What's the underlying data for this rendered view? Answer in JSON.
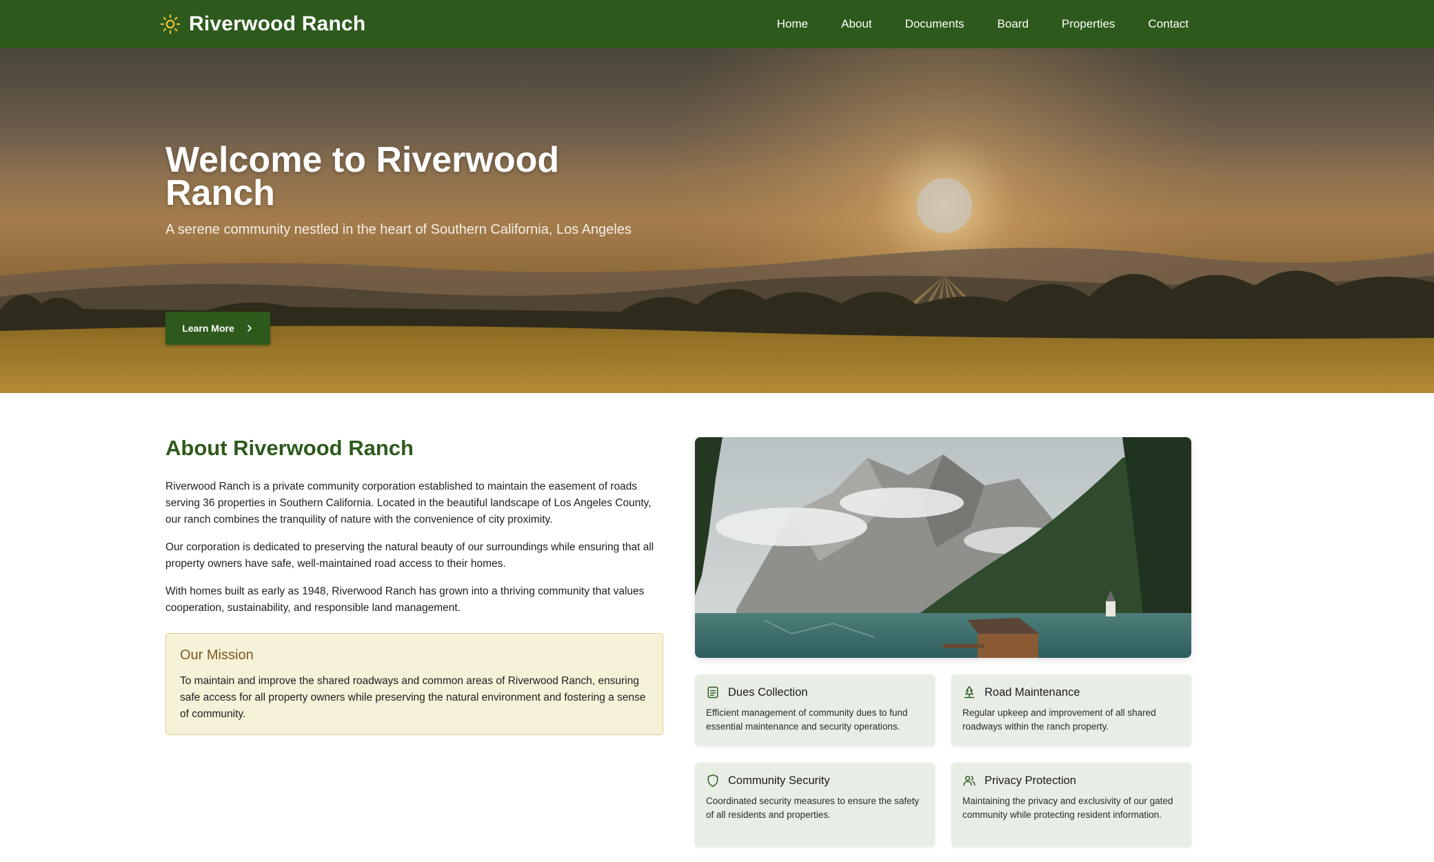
{
  "brand": {
    "name": "Riverwood Ranch",
    "icon": "sun-icon"
  },
  "nav": {
    "items": [
      {
        "label": "Home"
      },
      {
        "label": "About"
      },
      {
        "label": "Documents"
      },
      {
        "label": "Board"
      },
      {
        "label": "Properties"
      },
      {
        "label": "Contact"
      }
    ]
  },
  "hero": {
    "title": "Welcome to Riverwood Ranch",
    "subtitle": "A serene community nestled in the heart of Southern California, Los Angeles",
    "button_label": "Learn More",
    "button_icon": "chevron-right-icon"
  },
  "about": {
    "title": "About Riverwood Ranch",
    "paragraphs": [
      "Riverwood Ranch is a private community corporation established to maintain the easement of roads serving 36 properties in Southern California. Located in the beautiful landscape of Los Angeles County, our ranch combines the tranquility of nature with the convenience of city proximity.",
      "Our corporation is dedicated to preserving the natural beauty of our surroundings while ensuring that all property owners have safe, well-maintained road access to their homes.",
      "With homes built as early as 1948, Riverwood Ranch has grown into a thriving community that values cooperation, sustainability, and responsible land management."
    ]
  },
  "mission": {
    "title": "Our Mission",
    "text": "To maintain and improve the shared roadways and common areas of Riverwood Ranch, ensuring safe access for all property owners while preserving the natural environment and fostering a sense of community."
  },
  "features": [
    {
      "title": "Dues Collection",
      "icon": "document-icon",
      "description": "Efficient management of community dues to fund essential maintenance and security operations."
    },
    {
      "title": "Road Maintenance",
      "icon": "tree-icon",
      "description": "Regular upkeep and improvement of all shared roadways within the ranch property."
    },
    {
      "title": "Community Security",
      "icon": "shield-icon",
      "description": "Coordinated security measures to ensure the safety of all residents and properties."
    },
    {
      "title": "Privacy Protection",
      "icon": "users-icon",
      "description": "Maintaining the privacy and exclusivity of our gated community while protecting resident information."
    }
  ],
  "colors": {
    "primary_green": "#2d5a1c",
    "mission_background": "#f5f2d8",
    "mission_title": "#7c5a22",
    "card_background": "#e8eee6",
    "sun_icon": "#e8c33a"
  }
}
